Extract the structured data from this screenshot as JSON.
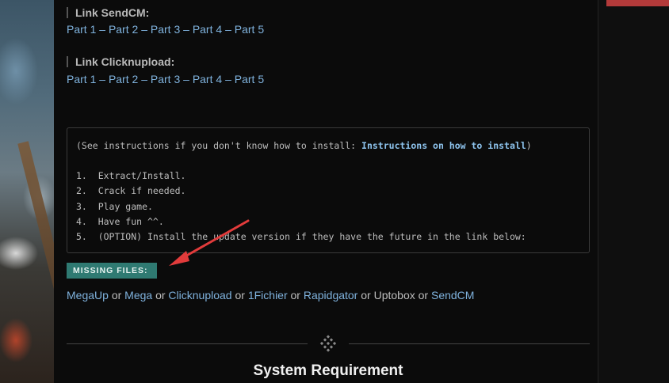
{
  "sections": [
    {
      "title": "Link SendCM:",
      "parts": [
        "Part 1",
        "Part 2",
        "Part 3",
        "Part 4",
        "Part 5"
      ]
    },
    {
      "title": "Link Clicknupload:",
      "parts": [
        "Part 1",
        "Part 2",
        "Part 3",
        "Part 4",
        "Part 5"
      ]
    }
  ],
  "separator": "–",
  "instructions": {
    "intro_prefix": "(See instructions if you don't know how to install: ",
    "intro_link": "Instructions on how to install",
    "intro_suffix": ")",
    "steps": [
      "1.  Extract/Install.",
      "2.  Crack if needed.",
      "3.  Play game.",
      "4.  Have fun ^^.",
      "5.  (OPTION) Install the update version if they have the future in the link below:"
    ]
  },
  "missing_files": {
    "label": "MISSING FILES:",
    "hosts": [
      {
        "name": "MegaUp",
        "link": true
      },
      {
        "name": "Mega",
        "link": true
      },
      {
        "name": "Clicknupload",
        "link": true
      },
      {
        "name": "1Fichier",
        "link": true
      },
      {
        "name": "Rapidgator",
        "link": true
      },
      {
        "name": "Uptobox",
        "link": false
      },
      {
        "name": "SendCM",
        "link": true
      }
    ],
    "joiner": "or"
  },
  "system_requirement_title": "System Requirement",
  "colors": {
    "link": "#7fb2dd",
    "badge": "#2f7a72",
    "arrow": "#e23b3b"
  }
}
